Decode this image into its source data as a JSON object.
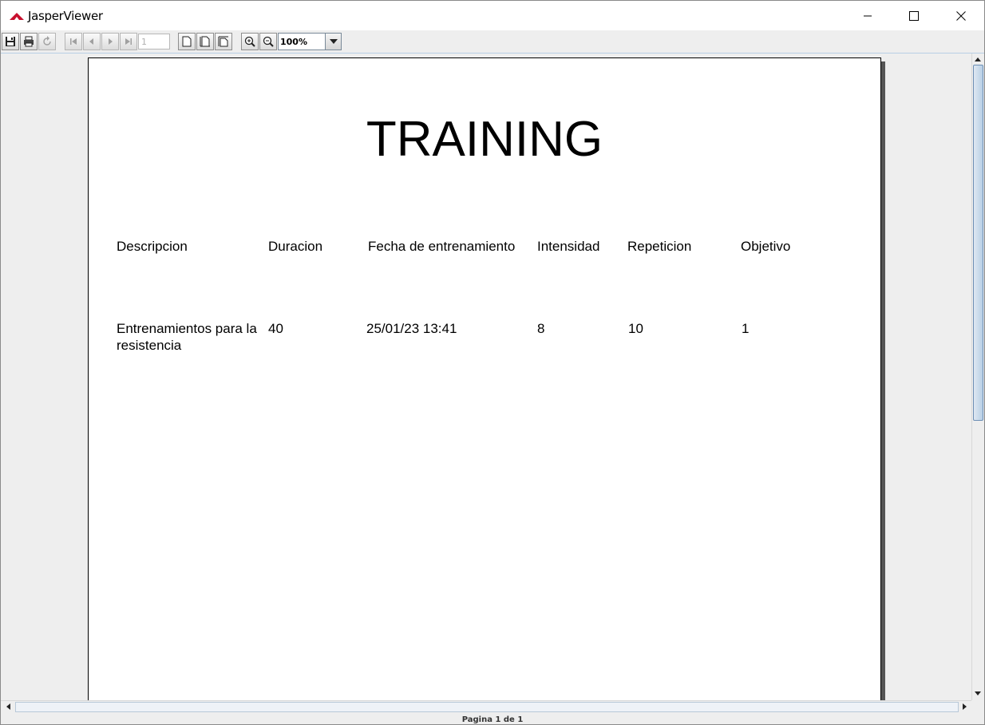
{
  "window": {
    "title": "JasperViewer"
  },
  "toolbar": {
    "page_number": "1",
    "zoom_value": "100%",
    "icons": [
      "save-icon",
      "print-icon",
      "reload-icon",
      "first-page-icon",
      "previous-page-icon",
      "next-page-icon",
      "last-page-icon",
      "actual-size-icon",
      "fit-page-icon",
      "fit-width-icon",
      "zoom-in-icon",
      "zoom-out-icon"
    ]
  },
  "report": {
    "title": "TRAINING",
    "columns": [
      "Descripcion",
      "Duracion",
      "Fecha de entrenamiento",
      "Intensidad",
      "Repeticion",
      "Objetivo"
    ],
    "rows": [
      [
        "Entrenamientos para la resistencia",
        "40",
        "25/01/23 13:41",
        "8",
        "10",
        "1"
      ]
    ]
  },
  "status": {
    "text": "Pagina 1 de 1"
  },
  "colors": {
    "accent_red": "#c8102e",
    "page_border": "#000000",
    "scroll_thumb": "#b8cfe5"
  }
}
